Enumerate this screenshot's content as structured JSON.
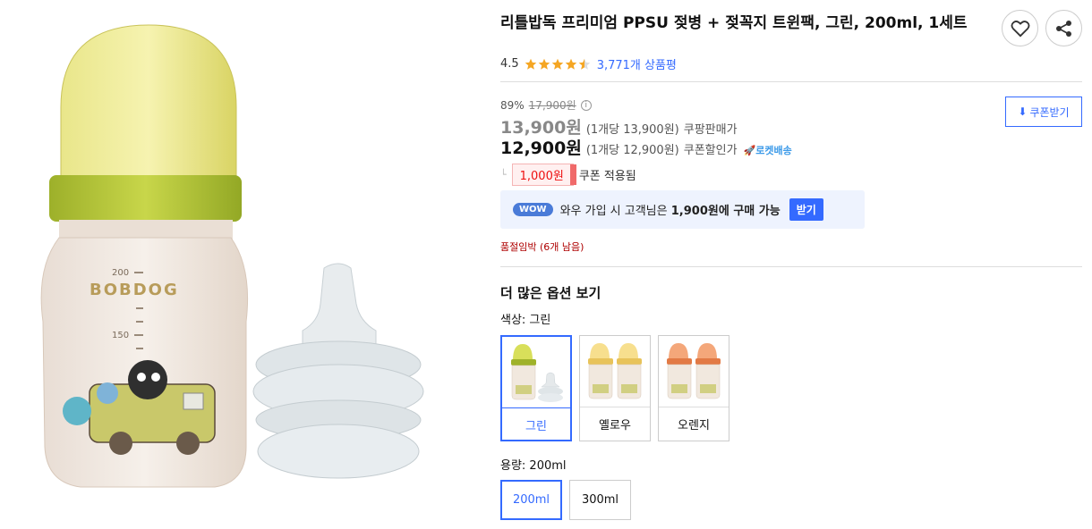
{
  "product": {
    "title": "리틀밥독 프리미엄 PPSU 젖병 + 젖꼭지 트윈팩, 그린, 200ml, 1세트",
    "rating_score": "4.5",
    "rating_fraction": 0.9,
    "review_count": "3,771개 상품평"
  },
  "image": {
    "brand_text": "BOBDOG",
    "scale_200": "200",
    "scale_150": "150"
  },
  "pricing": {
    "discount_rate": "89%",
    "original_price": "17,900원",
    "price_1": "13,900원",
    "price_1_unit": "(1개당 13,900원)",
    "price_1_label": "쿠팡판매가",
    "price_2": "12,900원",
    "price_2_unit": "(1개당 12,900원)",
    "price_2_label": "쿠폰할인가",
    "rocket_label": "로켓배송",
    "coupon_amount": "1,000원",
    "coupon_applied": "쿠폰 적용됨",
    "coupon_button": "쿠폰받기"
  },
  "wow": {
    "badge": "WOW",
    "text_before": "와우 가입 시 고객님은",
    "text_bold": "1,900원에 구매 가능",
    "button": "받기"
  },
  "stock_notice": "품절임박 (6개 남음)",
  "options": {
    "heading": "더 많은 옵션 보기",
    "color_label": "색상: 그린",
    "colors": [
      {
        "name": "그린",
        "cap": "#d8df5a",
        "ring": "#9fb22a",
        "selected": true
      },
      {
        "name": "옐로우",
        "cap": "#f7df8e",
        "ring": "#e8c35a",
        "selected": false
      },
      {
        "name": "오렌지",
        "cap": "#f4a77a",
        "ring": "#e27a45",
        "selected": false
      }
    ],
    "capacity_label": "용량: 200ml",
    "capacities": [
      {
        "name": "200ml",
        "selected": true
      },
      {
        "name": "300ml",
        "selected": false
      }
    ]
  },
  "colors": {
    "accent": "#346aff",
    "star": "#f5a623",
    "coupon_red": "#e11111",
    "stock_red": "#ae0000"
  },
  "icons": [
    "heart-icon",
    "share-icon",
    "star-icon",
    "info-icon",
    "download-icon",
    "rocket-icon"
  ]
}
